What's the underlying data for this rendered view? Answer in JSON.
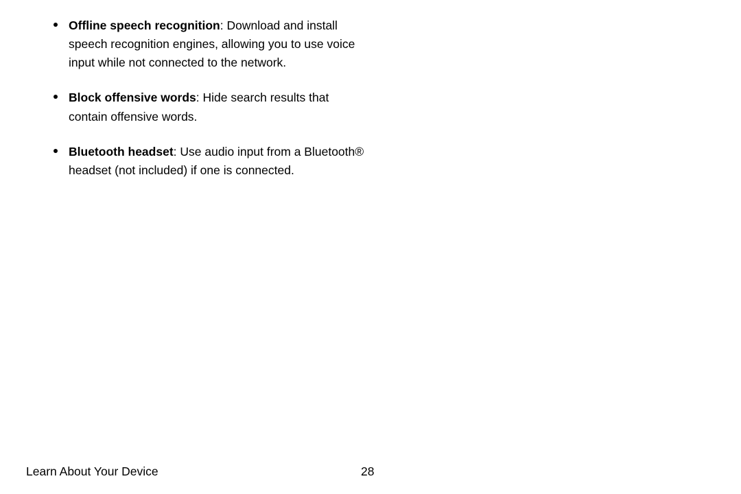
{
  "items": [
    {
      "term": "Offline speech recognition",
      "desc": ": Download and install speech recognition engines, allowing you to use voice input while not connected to the network."
    },
    {
      "term": "Block offensive words",
      "desc": ": Hide search results that contain offensive words."
    },
    {
      "term": "Bluetooth headset",
      "desc": ": Use audio input from a Bluetooth® headset (not included) if one is connected."
    }
  ],
  "footer": {
    "section": "Learn About Your Device",
    "page": "28"
  }
}
